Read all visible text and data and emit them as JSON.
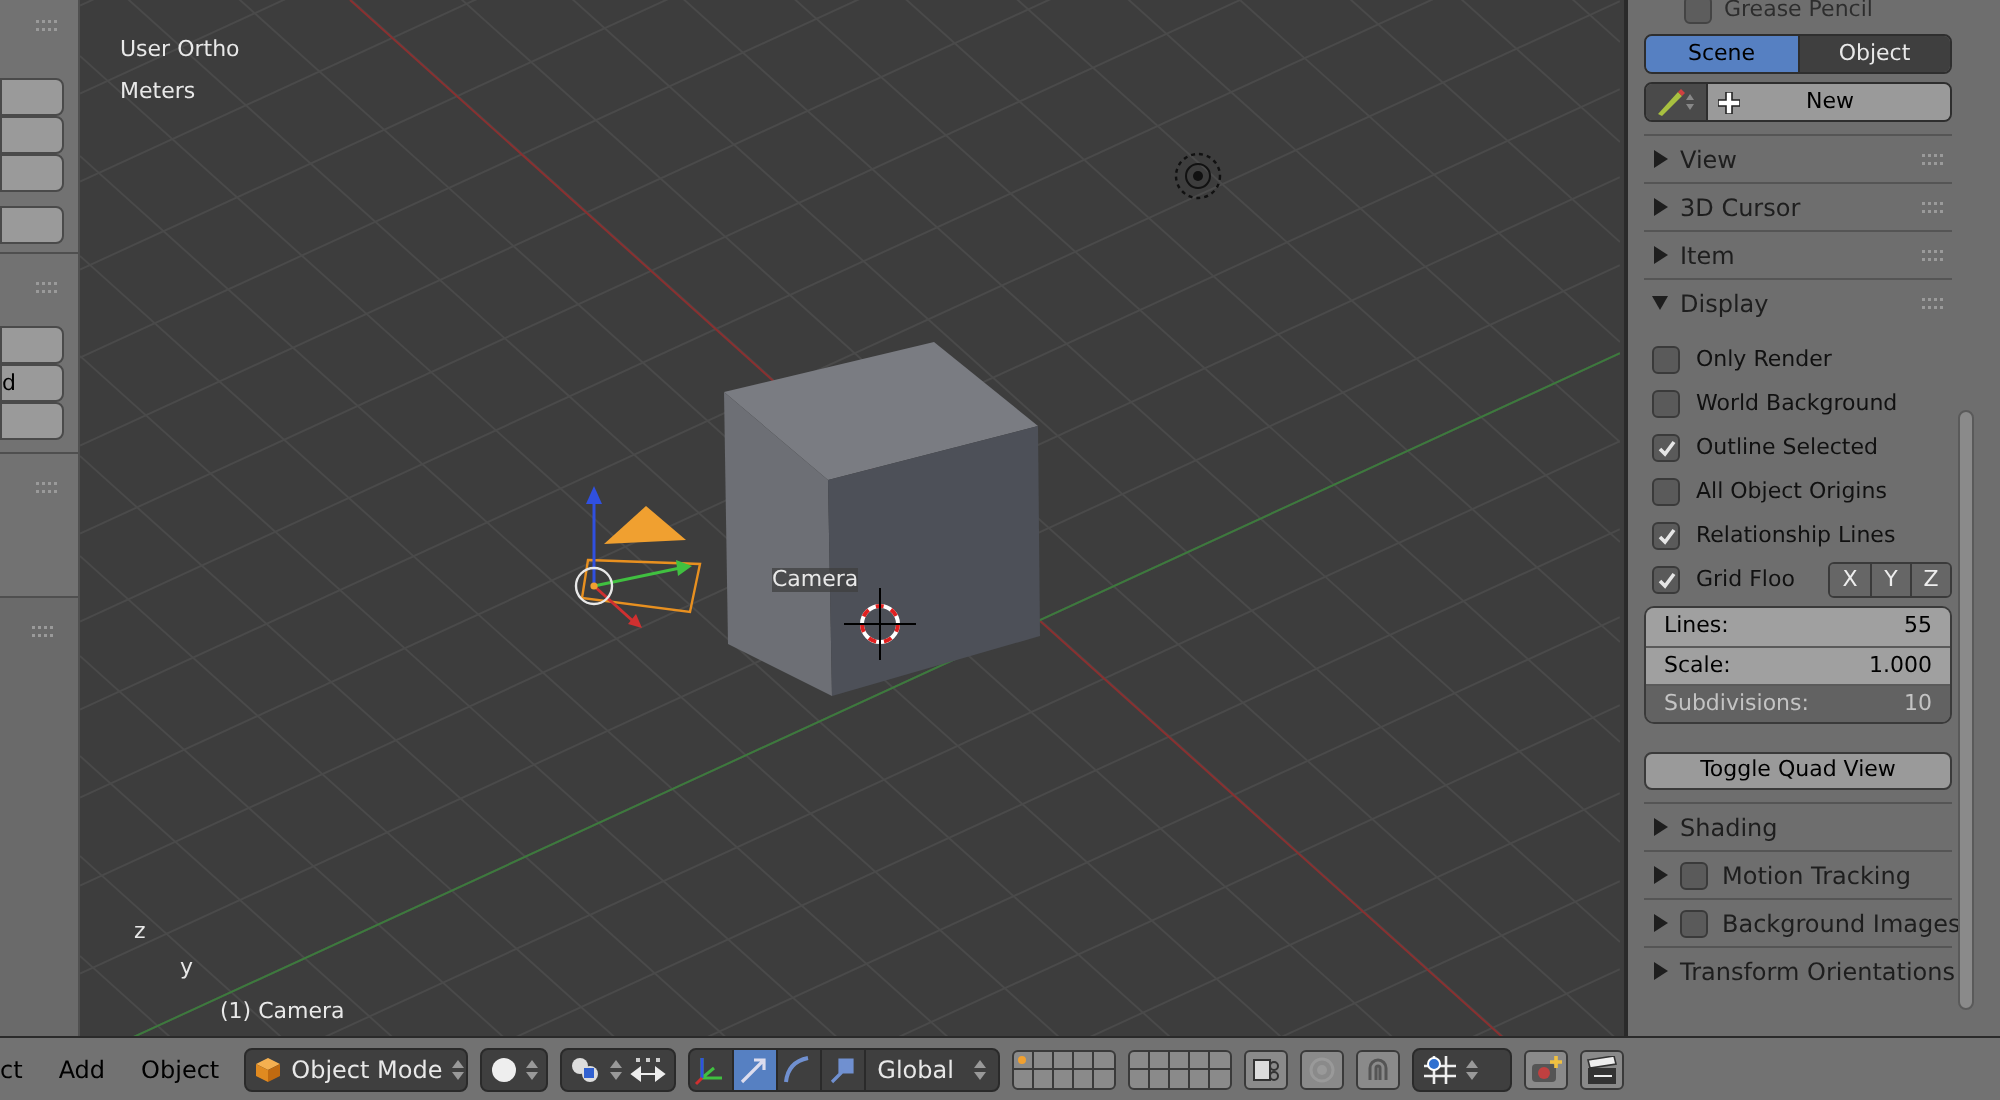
{
  "viewport": {
    "view_name": "User Ortho",
    "units": "Meters",
    "selection": "(1) Camera",
    "camera_label": "Camera",
    "axis_labels": [
      "z",
      "y"
    ]
  },
  "left_shelf": {
    "cut_label": "d"
  },
  "properties": {
    "top_panel": {
      "title": "Grease Pencil",
      "checked": false
    },
    "tabs": [
      {
        "label": "Scene",
        "selected": true
      },
      {
        "label": "Object",
        "selected": false
      }
    ],
    "new_button": "New",
    "panels": [
      {
        "title": "View",
        "expanded": false
      },
      {
        "title": "3D Cursor",
        "expanded": false
      },
      {
        "title": "Item",
        "expanded": false
      },
      {
        "title": "Display",
        "expanded": true
      }
    ],
    "display_options": [
      {
        "label": "Only Render",
        "checked": false
      },
      {
        "label": "World Background",
        "checked": false
      },
      {
        "label": "Outline Selected",
        "checked": true
      },
      {
        "label": "All Object Origins",
        "checked": false
      },
      {
        "label": "Relationship Lines",
        "checked": true
      },
      {
        "label": "Grid Floo",
        "checked": true
      }
    ],
    "grid_axes": [
      "X",
      "Y",
      "Z"
    ],
    "fields": [
      {
        "label": "Lines:",
        "value": "55",
        "disabled": false
      },
      {
        "label": "Scale:",
        "value": "1.000",
        "disabled": false
      },
      {
        "label": "Subdivisions:",
        "value": "10",
        "disabled": true
      }
    ],
    "quad_view_button": "Toggle Quad View",
    "lower_panels": [
      {
        "title": "Shading",
        "kind": "plain"
      },
      {
        "title": "Motion Tracking",
        "kind": "checkbox",
        "checked": false
      },
      {
        "title": "Background Images",
        "kind": "checkbox",
        "checked": false
      },
      {
        "title": "Transform Orientations",
        "kind": "plain"
      }
    ]
  },
  "header": {
    "menus": [
      "ct",
      "Add",
      "Object"
    ],
    "mode": "Object Mode",
    "orientation": "Global"
  }
}
